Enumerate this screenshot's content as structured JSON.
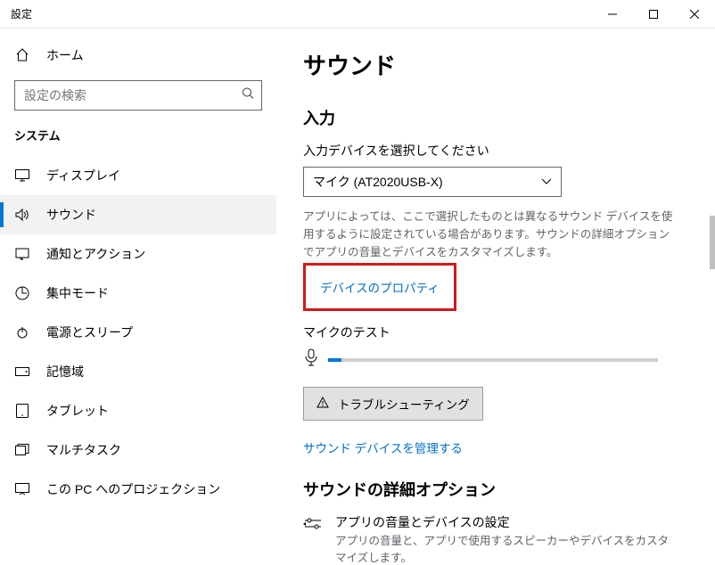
{
  "titlebar": {
    "title": "設定"
  },
  "sidebar": {
    "home_label": "ホーム",
    "search_placeholder": "設定の検索",
    "section_title": "システム",
    "items": [
      {
        "label": "ディスプレイ"
      },
      {
        "label": "サウンド"
      },
      {
        "label": "通知とアクション"
      },
      {
        "label": "集中モード"
      },
      {
        "label": "電源とスリープ"
      },
      {
        "label": "記憶域"
      },
      {
        "label": "タブレット"
      },
      {
        "label": "マルチタスク"
      },
      {
        "label": "この PC へのプロジェクション"
      }
    ]
  },
  "content": {
    "page_heading": "サウンド",
    "input_section_heading": "入力",
    "select_label": "入力デバイスを選択してください",
    "selected_device": "マイク (AT2020USB-X)",
    "helper_text": "アプリによっては、ここで選択したものとは異なるサウンド デバイスを使用するように設定されている場合があります。サウンドの詳細オプションでアプリの音量とデバイスをカスタマイズします。",
    "device_properties_link": "デバイスのプロパティ",
    "mic_test_label": "マイクのテスト",
    "troubleshoot_label": "トラブルシューティング",
    "manage_devices_link": "サウンド デバイスを管理する",
    "advanced_heading": "サウンドの詳細オプション",
    "advanced_item_title": "アプリの音量とデバイスの設定",
    "advanced_item_desc": "アプリの音量と、アプリで使用するスピーカーやデバイスをカスタマイズします。"
  }
}
